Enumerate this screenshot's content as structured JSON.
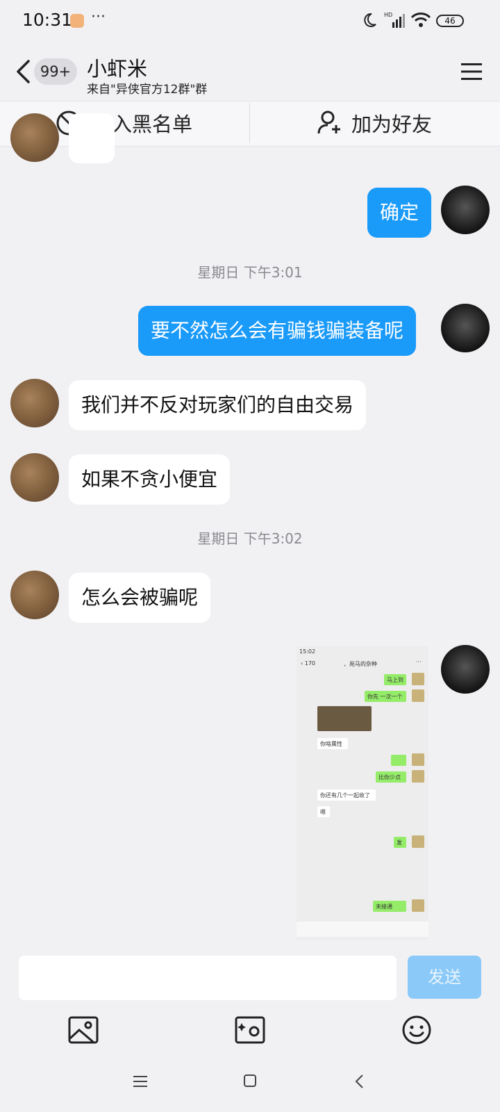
{
  "status_bar": {
    "time": "10:31",
    "battery": "46"
  },
  "header": {
    "badge": "99+",
    "title": "小虾米",
    "subtitle": "来自\"异侠官方12群\"群"
  },
  "actions": {
    "block": "加入黑名单",
    "add_friend": "加为好友"
  },
  "messages": {
    "m0": "",
    "m1": "确定",
    "ts1": "星期日 下午3:01",
    "m2": "要不然怎么会有骗钱骗装备呢",
    "m3": "我们并不反对玩家们的自由交易",
    "m4": "如果不贪小便宜",
    "ts2": "星期日 下午3:02",
    "m5": "怎么会被骗呢"
  },
  "screenshot": {
    "time": "15:02",
    "back_count": "170",
    "title": "、苑马的杂种",
    "b1": "马上到",
    "b2": "你先 一次一个",
    "b3": "你啥属性",
    "b4": "比你少点",
    "b5": "你还有几个一起收了",
    "b6": "嗯",
    "b7": "发",
    "b8": "未接通"
  },
  "input_bar": {
    "placeholder": "",
    "send": "发送"
  },
  "colors": {
    "accent": "#1a9af9",
    "send_disabled": "#8ac9f8",
    "background": "#f1f1f4"
  }
}
